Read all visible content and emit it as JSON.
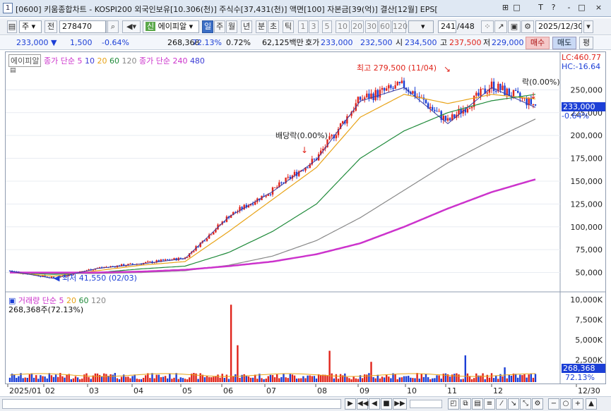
{
  "window": {
    "number": "1",
    "title": "[0600] 키움종합차트 - KOSPI200 외국인보유[10.306(천)] 주식수[37,431(천)] 액면[100] 자본금[39(억)] 결산[12월] EPS[",
    "buttons": [
      "⊞",
      "□",
      "T",
      "?",
      "-",
      "□",
      "×"
    ]
  },
  "toolbar": {
    "type_select": "주",
    "jeon_button": "전",
    "code": "278470",
    "stock_name": "에이피알",
    "period_buttons": [
      "일",
      "주",
      "월",
      "년",
      "분",
      "초",
      "틱"
    ],
    "active_period": "일",
    "interval_buttons": [
      "1",
      "3",
      "5",
      "10",
      "20",
      "30",
      "60",
      "120"
    ],
    "count": "241",
    "count_total": "/448",
    "date": "2025/12/30"
  },
  "quote": {
    "price": "233,000",
    "change": "1,500",
    "change_rate": "-0.64%",
    "volume": "268,368",
    "vol_ratio": "72.13%",
    "turnover": "0.72%",
    "amount": "62,125백만",
    "hoga_label": "호가",
    "ask": "233,000",
    "bid": "232,500",
    "open_label": "시",
    "open": "234,500",
    "high_label": "고",
    "high": "237,500",
    "low_label": "저",
    "low": "229,000",
    "buy": "매수",
    "sell": "매도",
    "flat": "평"
  },
  "chart": {
    "stock_label": "에이피알",
    "ma_label_short": "종가 단순 5",
    "ma_periods_short": [
      "10",
      "20",
      "60",
      "120"
    ],
    "ma_label_long": "종가 단순 240",
    "ma_long_2": "480",
    "lc": "LC:460.77",
    "hc": "HC:-16.64",
    "current_price_tag": "233,000",
    "current_change_tag": "-0.64%",
    "high_annotation": "최고 279,500 (11/04)",
    "low_annotation": "최저 41,550 (02/03)",
    "dividend_1": "배당락(0.00%)",
    "dividend_2": "락(0.00%)",
    "volume_label": "거래량",
    "volume_ma_label": "단순 5",
    "volume_ma_periods": [
      "20",
      "60",
      "120"
    ],
    "volume_value": "268,368주(72.13%)",
    "volume_tag": "268,368",
    "volume_tag_pct": "72.13%",
    "y_labels": [
      "250,000",
      "225,000",
      "200,000",
      "175,000",
      "150,000",
      "125,000",
      "100,000",
      "75,000",
      "50,000"
    ],
    "vol_y_labels": [
      "10,000K",
      "7,500K",
      "5,000K",
      "2,500K"
    ],
    "x_labels": [
      "2025/01",
      "02",
      "03",
      "04",
      "05",
      "06",
      "07",
      "08",
      "09",
      "10",
      "11",
      "12",
      "12/30"
    ],
    "colors": {
      "up": "#e0241b",
      "down": "#1c3fd6",
      "ma5": "#3a3a9e",
      "ma20": "#e8a317",
      "ma60": "#1f8a3a",
      "ma120": "#888888",
      "ma240": "#cc33cc",
      "ma480": "#3b3bd6"
    }
  },
  "chart_data": {
    "type": "line",
    "title": "",
    "x": [
      "2025/01",
      "02",
      "03",
      "04",
      "05",
      "06",
      "07",
      "08",
      "09",
      "10",
      "11",
      "12",
      "12/30"
    ],
    "series": [
      {
        "name": "종가",
        "values": [
          52000,
          44000,
          55000,
          60000,
          66000,
          112000,
          140000,
          175000,
          240000,
          255000,
          215000,
          255000,
          233000
        ]
      },
      {
        "name": "20",
        "values": [
          50000,
          46000,
          52000,
          58000,
          62000,
          95000,
          130000,
          165000,
          220000,
          245000,
          235000,
          245000,
          240000
        ]
      },
      {
        "name": "60",
        "values": [
          50000,
          48000,
          50000,
          54000,
          57000,
          72000,
          95000,
          125000,
          175000,
          205000,
          225000,
          238000,
          245000
        ]
      },
      {
        "name": "120",
        "values": [
          50000,
          49000,
          49000,
          50000,
          52000,
          58000,
          68000,
          85000,
          110000,
          140000,
          170000,
          195000,
          218000
        ]
      },
      {
        "name": "240",
        "values": [
          50000,
          50000,
          50000,
          51000,
          53000,
          57000,
          62000,
          70000,
          82000,
          100000,
          120000,
          138000,
          152000
        ]
      }
    ],
    "ylabel": "",
    "ylim": [
      35000,
      285000
    ],
    "high": {
      "label": "최고",
      "value": 279500,
      "date": "11/04"
    },
    "low": {
      "label": "최저",
      "value": 41550,
      "date": "02/03"
    }
  },
  "scroll": {
    "buttons": [
      "▶",
      "◀◀",
      "◀",
      "■",
      "▶▶"
    ]
  }
}
